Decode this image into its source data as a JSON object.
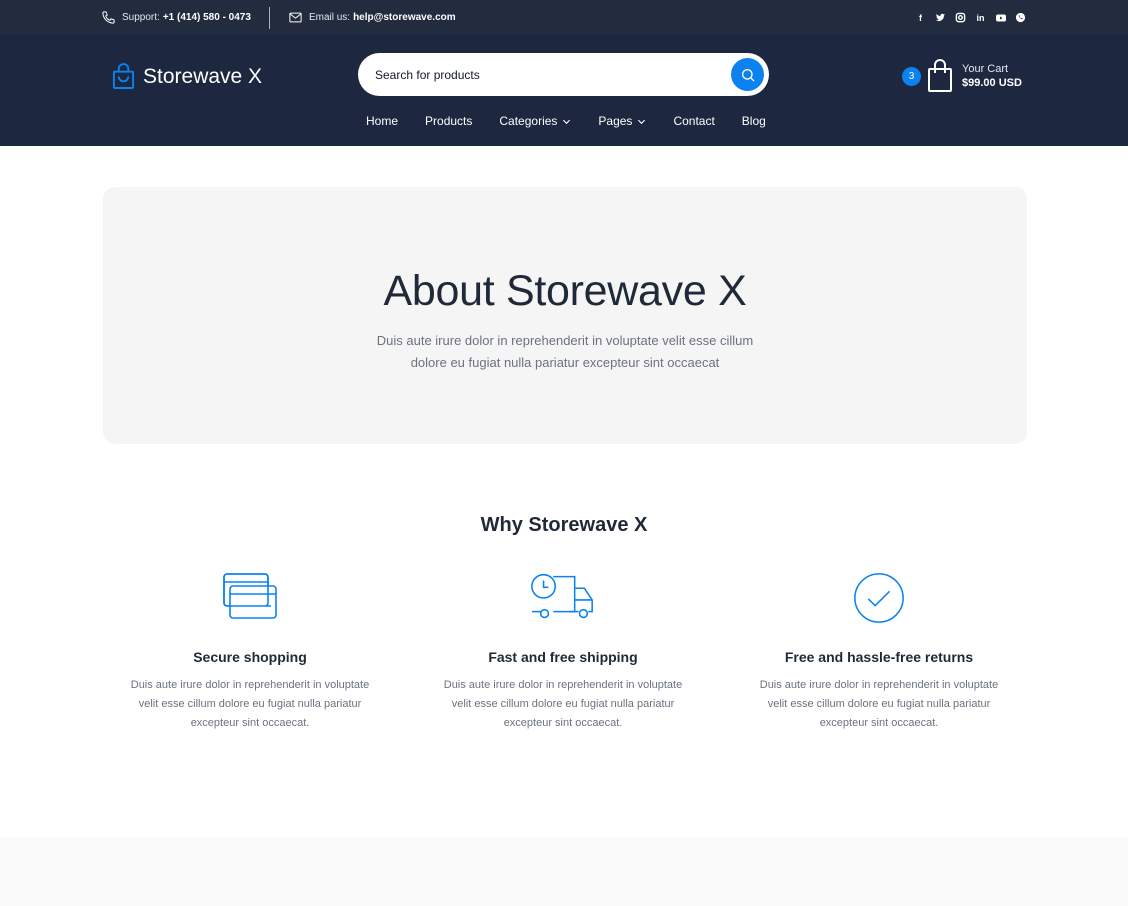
{
  "topbar": {
    "support_label": "Support:",
    "support_phone": "+1 (414) 580 - 0473",
    "email_label": "Email us:",
    "email": "help@storewave.com",
    "socials": [
      "facebook-icon",
      "twitter-icon",
      "instagram-icon",
      "linkedin-icon",
      "youtube-icon",
      "whatsapp-icon"
    ]
  },
  "header": {
    "logo_text": "Storewave X",
    "search_placeholder": "Search for products",
    "nav": {
      "home": "Home",
      "products": "Products",
      "categories": "Categories",
      "pages": "Pages",
      "contact": "Contact",
      "blog": "Blog"
    },
    "cart": {
      "count": "3",
      "label": "Your Cart",
      "total": "$99.00 USD"
    }
  },
  "hero": {
    "title": "About Storewave X",
    "description": "Duis aute irure dolor in reprehenderit in voluptate velit esse cillum dolore eu fugiat nulla pariatur excepteur sint occaecat"
  },
  "why": {
    "title": "Why  Storewave X",
    "features": [
      {
        "icon": "credit-card-icon",
        "title": "Secure shopping",
        "text": "Duis aute irure dolor in reprehenderit in voluptate velit esse cillum dolore eu fugiat nulla pariatur excepteur sint occaecat."
      },
      {
        "icon": "delivery-truck-icon",
        "title": "Fast and free shipping",
        "text": "Duis aute irure dolor in reprehenderit in voluptate velit esse cillum dolore eu fugiat nulla pariatur excepteur sint occaecat."
      },
      {
        "icon": "check-circle-icon",
        "title": "Free and hassle-free returns",
        "text": "Duis aute irure dolor in reprehenderit in voluptate velit esse cillum dolore eu fugiat nulla pariatur excepteur sint occaecat."
      }
    ]
  },
  "colors": {
    "topbar_bg": "#232b3e",
    "header_bg": "#1d2740",
    "accent": "#0b82f0",
    "hero_bg": "#f5f5f5"
  }
}
